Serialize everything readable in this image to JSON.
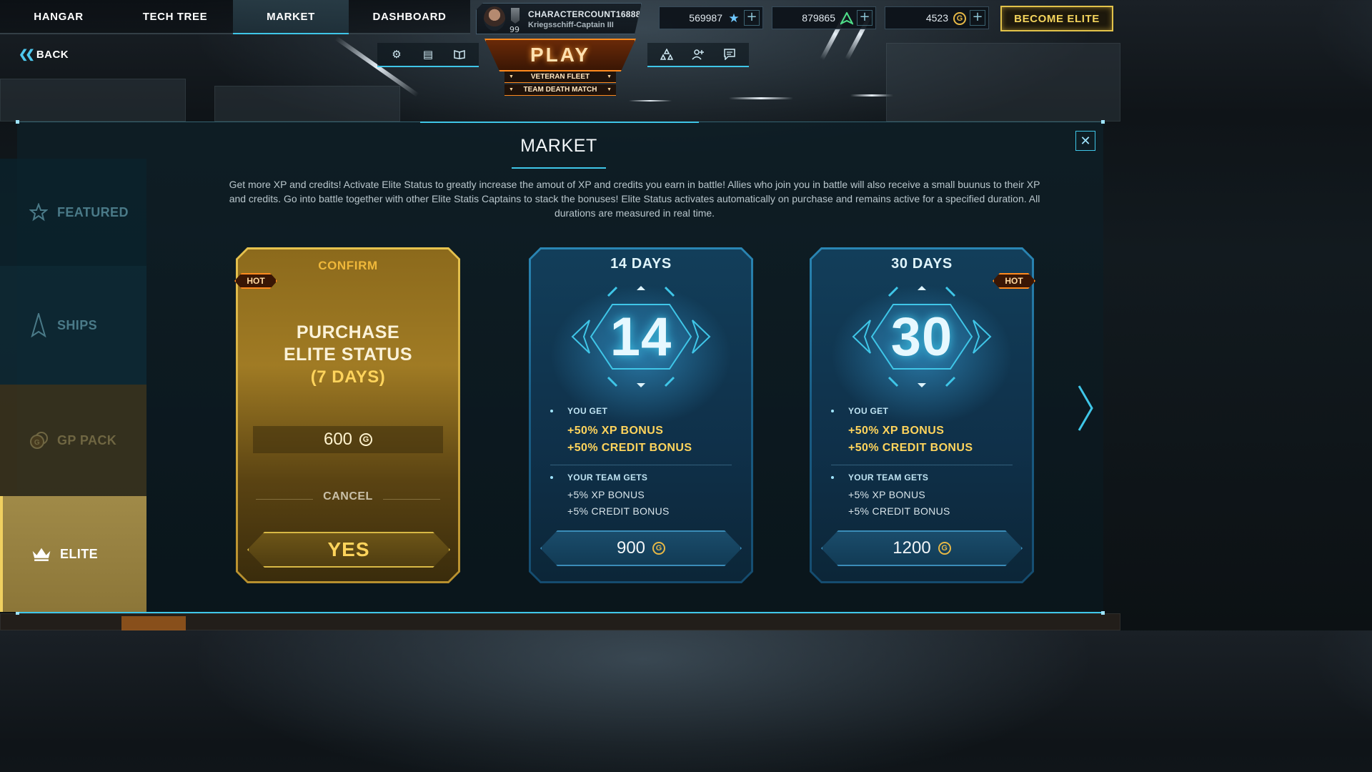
{
  "nav": {
    "tabs": [
      {
        "label": "HANGAR",
        "active": false
      },
      {
        "label": "TECH TREE",
        "active": false
      },
      {
        "label": "MARKET",
        "active": true
      },
      {
        "label": "DASHBOARD",
        "active": false
      }
    ]
  },
  "profile": {
    "name": "CHARACTERCOUNT16888",
    "ship": "Kriegsschiff-Captain III",
    "rank": "99"
  },
  "currencies": {
    "xp": {
      "value": "569987",
      "icon": "star-icon"
    },
    "tokens": {
      "value": "879865",
      "icon": "fleet-token-icon"
    },
    "gold": {
      "value": "4523",
      "icon": "gold-coin-icon",
      "symbol": "G"
    }
  },
  "become_elite": "BECOME ELITE",
  "back": "BACK",
  "play": {
    "label": "PLAY",
    "fleet_mode": "VETERAN FLEET",
    "game_mode": "TEAM DEATH MATCH"
  },
  "market": {
    "title": "MARKET",
    "description": "Get more XP and credits! Activate Elite Status to greatly increase the amout of XP and credits you earn in battle! Allies who join you in battle will also receive a small buunus to their XP and credits. Go into battle together with other Elite Statis Captains to stack the bonuses! Elite Status activates automatically on purchase and remains active for a specified duration. All durations are measured in real time."
  },
  "sidebar": {
    "items": [
      {
        "label": "FEATURED",
        "icon": "star-outline-icon"
      },
      {
        "label": "SHIPS",
        "icon": "ship-icon"
      },
      {
        "label": "GP PACK",
        "icon": "coin-stack-icon"
      },
      {
        "label": "ELITE",
        "icon": "crown-icon"
      }
    ]
  },
  "cards": {
    "confirm": {
      "header": "CONFIRM",
      "badge": "HOT",
      "title_line1": "PURCHASE",
      "title_line2": "ELITE STATUS",
      "days": "(7 DAYS)",
      "price": "600",
      "cancel": "CANCEL",
      "yes": "YES"
    },
    "d14": {
      "header": "14 DAYS",
      "number": "14",
      "you_get": "YOU GET",
      "xp_bonus": "+50% XP BONUS",
      "credit_bonus": "+50% CREDIT BONUS",
      "team_gets": "YOUR TEAM GETS",
      "team_xp": "+5% XP BONUS",
      "team_credit": "+5% CREDIT BONUS",
      "price": "900"
    },
    "d30": {
      "header": "30 DAYS",
      "badge": "HOT",
      "number": "30",
      "you_get": "YOU GET",
      "xp_bonus": "+50% XP BONUS",
      "credit_bonus": "+50% CREDIT BONUS",
      "team_gets": "YOUR TEAM GETS",
      "team_xp": "+5% XP BONUS",
      "team_credit": "+5% CREDIT BONUS",
      "price": "1200"
    }
  },
  "colors": {
    "accent": "#3fc6e8",
    "gold": "#ffd45c",
    "play_orange": "#ff8a1e"
  }
}
